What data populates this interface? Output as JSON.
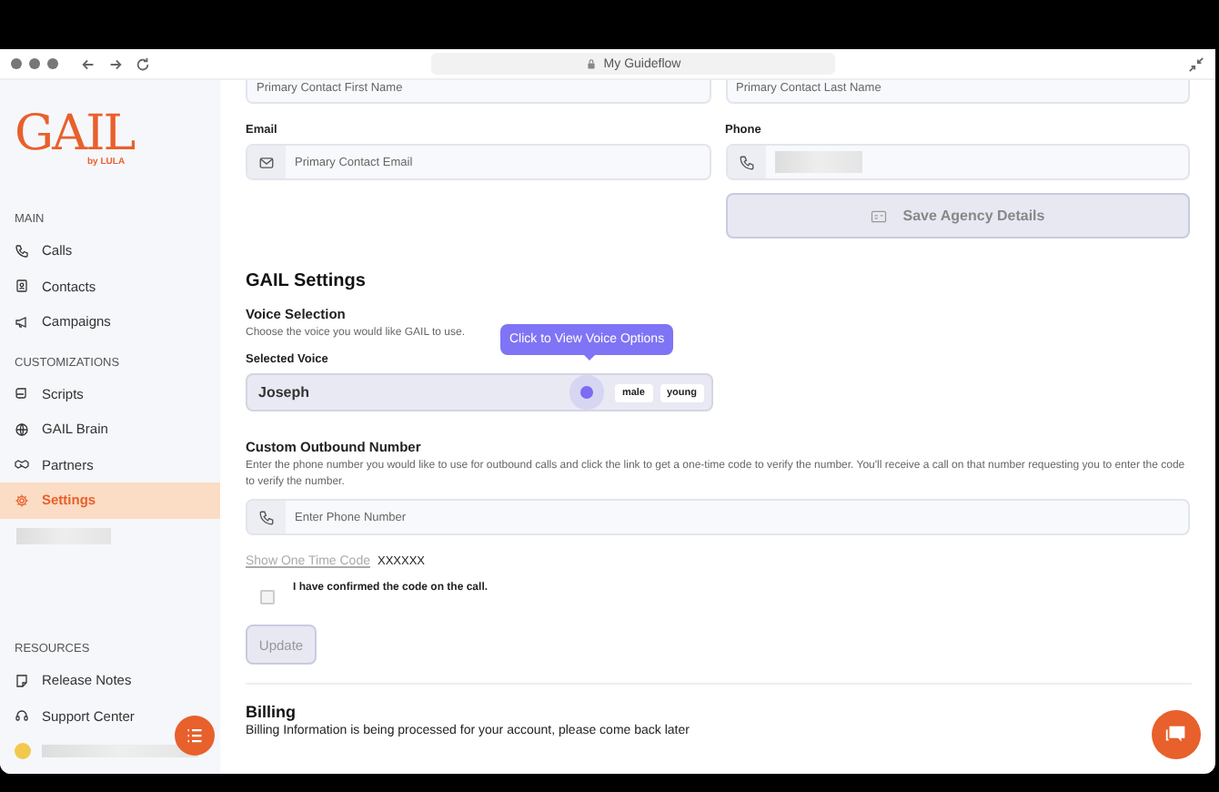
{
  "browser": {
    "title": "My Guideflow"
  },
  "brand": {
    "logo": "GAIL",
    "byline": "by LULA"
  },
  "sidebar": {
    "sections": [
      {
        "title": "MAIN",
        "items": [
          {
            "label": "Calls",
            "selected": false
          },
          {
            "label": "Contacts",
            "selected": false
          },
          {
            "label": "Campaigns",
            "selected": false
          }
        ]
      },
      {
        "title": "CUSTOMIZATIONS",
        "items": [
          {
            "label": "Scripts",
            "selected": false
          },
          {
            "label": "GAIL Brain",
            "selected": false
          },
          {
            "label": "Partners",
            "selected": false
          },
          {
            "label": "Settings",
            "selected": true
          }
        ]
      },
      {
        "title": "RESOURCES",
        "items": [
          {
            "label": "Release Notes",
            "selected": false
          },
          {
            "label": "Support Center",
            "selected": false
          }
        ]
      }
    ]
  },
  "agency": {
    "first_name": {
      "placeholder": "Primary Contact First Name"
    },
    "last_name": {
      "placeholder": "Primary Contact Last Name"
    },
    "email": {
      "label": "Email",
      "placeholder": "Primary Contact Email"
    },
    "phone": {
      "label": "Phone"
    },
    "save_button": {
      "label": "Save Agency Details",
      "disabled": true
    }
  },
  "gail_settings": {
    "title": "GAIL Settings",
    "voice": {
      "title": "Voice Selection",
      "description": "Choose the voice you would like GAIL to use.",
      "label": "Selected Voice",
      "value": "Joseph",
      "tags": [
        "male",
        "young"
      ],
      "tooltip": "Click to View Voice Options"
    },
    "outbound": {
      "title": "Custom Outbound Number",
      "description": "Enter the phone number you would like to use for outbound calls and click the link to get a one-time code to verify the number. You'll receive a call on that number requesting you to enter the code to verify the number.",
      "placeholder": "Enter Phone Number",
      "code_link": "Show One Time Code",
      "code": "XXXXXX",
      "confirm_label": "I have confirmed the code on the call.",
      "confirmed": false,
      "update_button": {
        "label": "Update",
        "disabled": true
      }
    }
  },
  "billing": {
    "title": "Billing",
    "text": "Billing Information is being processed for your account, please come back later"
  }
}
